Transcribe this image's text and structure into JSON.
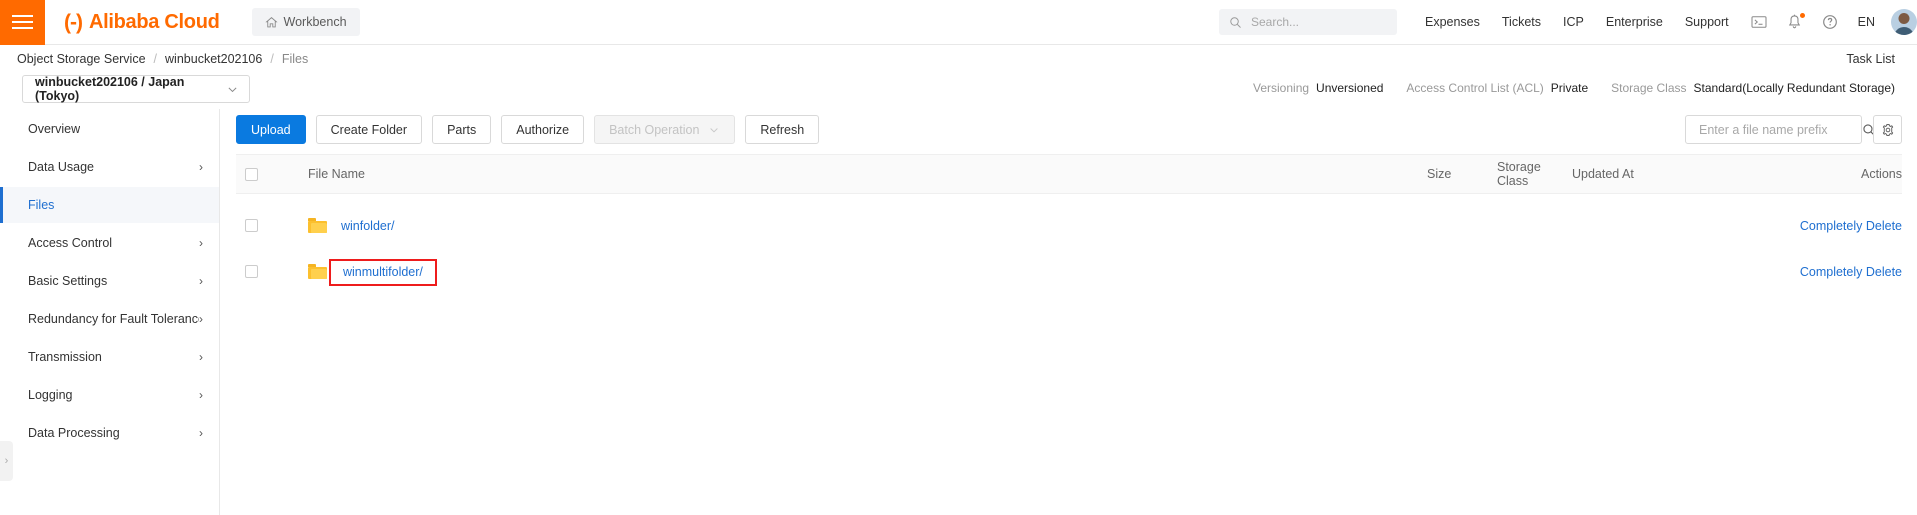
{
  "topbar": {
    "menu_icon": "hamburger-icon",
    "brand_mark": "(-)",
    "brand_name": "Alibaba Cloud",
    "workbench_label": "Workbench",
    "workbench_icon": "home-icon",
    "search_placeholder": "Search...",
    "search_value": "",
    "search_icon": "search-icon",
    "links": [
      "Expenses",
      "Tickets",
      "ICP",
      "Enterprise",
      "Support"
    ],
    "icons": [
      "terminal-icon",
      "bell-icon",
      "help-circle-icon"
    ],
    "language": "EN",
    "avatar": "user-avatar"
  },
  "breadcrumb": {
    "items": [
      "Object Storage Service",
      "winbucket202106",
      "Files"
    ],
    "separator": "/",
    "task_list_label": "Task List"
  },
  "bucket": {
    "selected": "winbucket202106 / Japan (Tokyo)",
    "chevron": "chevron-down-icon",
    "meta": [
      {
        "label": "Versioning",
        "value": "Unversioned"
      },
      {
        "label": "Access Control List (ACL)",
        "value": "Private"
      },
      {
        "label": "Storage Class",
        "value": "Standard(Locally Redundant Storage)"
      }
    ]
  },
  "sidebar": {
    "items": [
      {
        "label": "Overview",
        "has_chevron": false,
        "active": false
      },
      {
        "label": "Data Usage",
        "has_chevron": true,
        "active": false
      },
      {
        "label": "Files",
        "has_chevron": false,
        "active": true
      },
      {
        "label": "Access Control",
        "has_chevron": true,
        "active": false
      },
      {
        "label": "Basic Settings",
        "has_chevron": true,
        "active": false
      },
      {
        "label": "Redundancy for Fault Tolerance",
        "has_chevron": true,
        "active": false
      },
      {
        "label": "Transmission",
        "has_chevron": true,
        "active": false
      },
      {
        "label": "Logging",
        "has_chevron": true,
        "active": false
      },
      {
        "label": "Data Processing",
        "has_chevron": true,
        "active": false
      }
    ],
    "collapse_icon": "chevron-right-icon"
  },
  "toolbar": {
    "upload_label": "Upload",
    "create_folder_label": "Create Folder",
    "parts_label": "Parts",
    "authorize_label": "Authorize",
    "batch_operation_label": "Batch Operation",
    "batch_operation_disabled": true,
    "refresh_label": "Refresh",
    "search_placeholder": "Enter a file name prefix",
    "search_value": "",
    "search_icon": "search-icon",
    "settings_icon": "gear-icon",
    "primary_color": "#0a7ae0"
  },
  "table": {
    "columns": [
      "File Name",
      "Size",
      "Storage Class",
      "Updated At",
      "Actions"
    ],
    "rows": [
      {
        "name": "winfolder/",
        "icon": "folder-icon",
        "size": "",
        "storage_class": "",
        "updated_at": "",
        "action": "Completely Delete",
        "highlighted": false,
        "checked": false
      },
      {
        "name": "winmultifolder/",
        "icon": "folder-icon",
        "size": "",
        "storage_class": "",
        "updated_at": "",
        "action": "Completely Delete",
        "highlighted": true,
        "checked": false
      }
    ],
    "highlight_color": "#ee1c1c",
    "link_color": "#1f6fd0"
  }
}
